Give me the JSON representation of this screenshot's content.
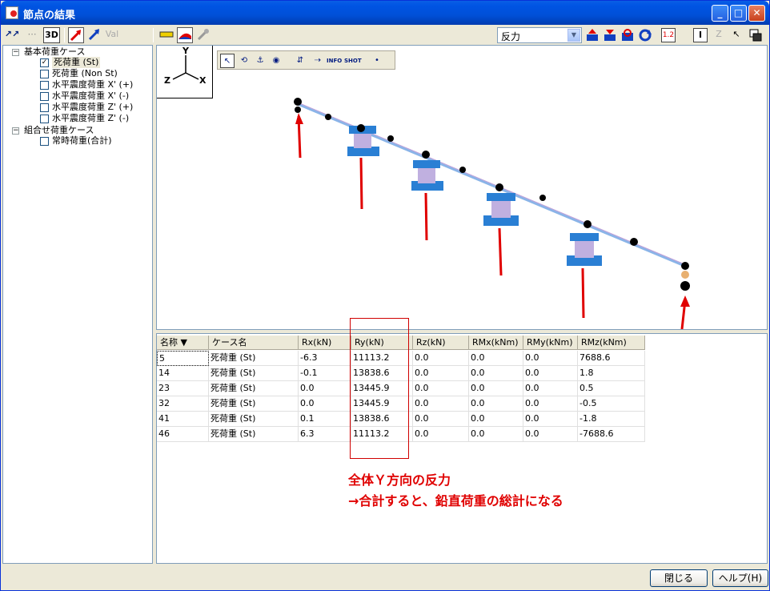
{
  "window": {
    "title": "節点の結果"
  },
  "toolbar": {
    "left_tools": [
      "↗↗",
      "⋯",
      "3D"
    ],
    "combo_value": "反力"
  },
  "tree": {
    "groups": [
      {
        "label": "基本荷重ケース",
        "items": [
          {
            "label": "死荷重 (St)",
            "checked": true
          },
          {
            "label": "死荷重 (Non St)",
            "checked": false
          },
          {
            "label": "水平震度荷重 X' (+)",
            "checked": false
          },
          {
            "label": "水平震度荷重 X' (-)",
            "checked": false
          },
          {
            "label": "水平震度荷重 Z' (+)",
            "checked": false
          },
          {
            "label": "水平震度荷重 Z' (-)",
            "checked": false
          }
        ]
      },
      {
        "label": "組合せ荷重ケース",
        "items": [
          {
            "label": "常時荷重(合計)",
            "checked": false
          }
        ]
      }
    ]
  },
  "axes": {
    "y": "Y",
    "z": "Z",
    "x": "X"
  },
  "view_tools": [
    "↖",
    "⟲",
    "⚓",
    "◉",
    "⇵",
    "⇢",
    "INFO",
    "SHOT",
    "•"
  ],
  "table": {
    "columns": [
      "名称 ▼",
      "ケース名",
      "Rx(kN)",
      "Ry(kN)",
      "Rz(kN)",
      "RMx(kNm)",
      "RMy(kNm)",
      "RMz(kNm)"
    ],
    "rows": [
      [
        "5",
        "死荷重 (St)",
        "-6.3",
        "11113.2",
        "0.0",
        "0.0",
        "0.0",
        "7688.6"
      ],
      [
        "14",
        "死荷重 (St)",
        "-0.1",
        "13838.6",
        "0.0",
        "0.0",
        "0.0",
        "1.8"
      ],
      [
        "23",
        "死荷重 (St)",
        "0.0",
        "13445.9",
        "0.0",
        "0.0",
        "0.0",
        "0.5"
      ],
      [
        "32",
        "死荷重 (St)",
        "0.0",
        "13445.9",
        "0.0",
        "0.0",
        "0.0",
        "-0.5"
      ],
      [
        "41",
        "死荷重 (St)",
        "0.1",
        "13838.6",
        "0.0",
        "0.0",
        "0.0",
        "-1.8"
      ],
      [
        "46",
        "死荷重 (St)",
        "6.3",
        "11113.2",
        "0.0",
        "0.0",
        "0.0",
        "-7688.6"
      ]
    ]
  },
  "annotation": {
    "line1": "全体Ｙ方向の反力",
    "line2": "→合計すると、鉛直荷重の総計になる"
  },
  "buttons": {
    "close": "閉じる",
    "help": "ヘルプ(H)"
  },
  "colors": {
    "accent_red": "#e00000",
    "member_blue": "#8ab4e8",
    "support_blue": "#2a7fd4"
  }
}
